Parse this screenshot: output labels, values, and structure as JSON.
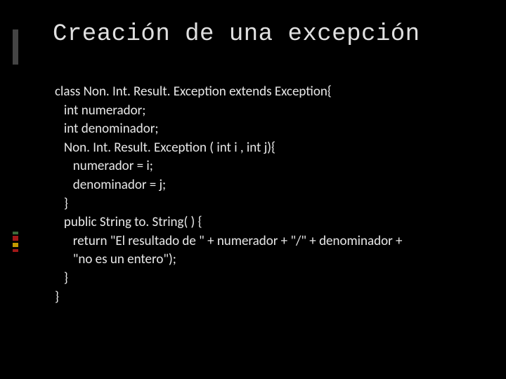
{
  "title": "Creación de una excepción",
  "code": {
    "l0": "class Non. Int. Result. Exception extends Exception{",
    "l1": "   int numerador;",
    "l2": "   int denominador;",
    "l3": "   Non. Int. Result. Exception ( int i , int j){",
    "l4": "      numerador = i;",
    "l5": "      denominador = j;",
    "l6": "   }",
    "l7": "   public String to. String( ) {",
    "l8": "      return \"El resultado de \" + numerador + \"/\" + denominador +",
    "l9": "      \"no es un entero\");",
    "l10": "   }",
    "l11": "}"
  },
  "colors": {
    "bg": "#000000",
    "text": "#e8e8e8",
    "accent_gray": "#444444",
    "accent_green": "#3a6b3a",
    "accent_red": "#a01818",
    "accent_yellow": "#c49a00"
  }
}
